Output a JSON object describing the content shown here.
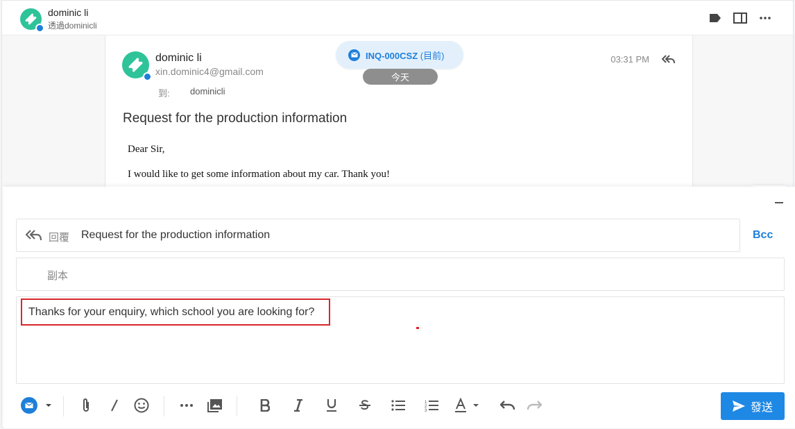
{
  "header": {
    "contact_name": "dominic li",
    "channel_sub": "透過dominicli"
  },
  "message": {
    "sender_name": "dominic li",
    "sender_email": "xin.dominic4@gmail.com",
    "to_label": "到:",
    "to_value": "dominicli",
    "time": "03:31 PM",
    "subject": "Request for the production information",
    "body": [
      "Dear Sir,",
      "I would like to get some information about my car. Thank you!"
    ]
  },
  "inquiry": {
    "id": "INQ-000CSZ",
    "status": "(目前)"
  },
  "date_divider": "今天",
  "reply": {
    "reply_label": "回覆",
    "subject_value": "Request for the production information",
    "bcc_label": "Bcc",
    "cc_placeholder": "副本",
    "editor_text": "Thanks for your enquiry, which school you are looking for?",
    "send_label": "發送"
  },
  "colors": {
    "accent": "#1e88e5",
    "avatar": "#2fc39a",
    "highlight": "#d8262c"
  }
}
